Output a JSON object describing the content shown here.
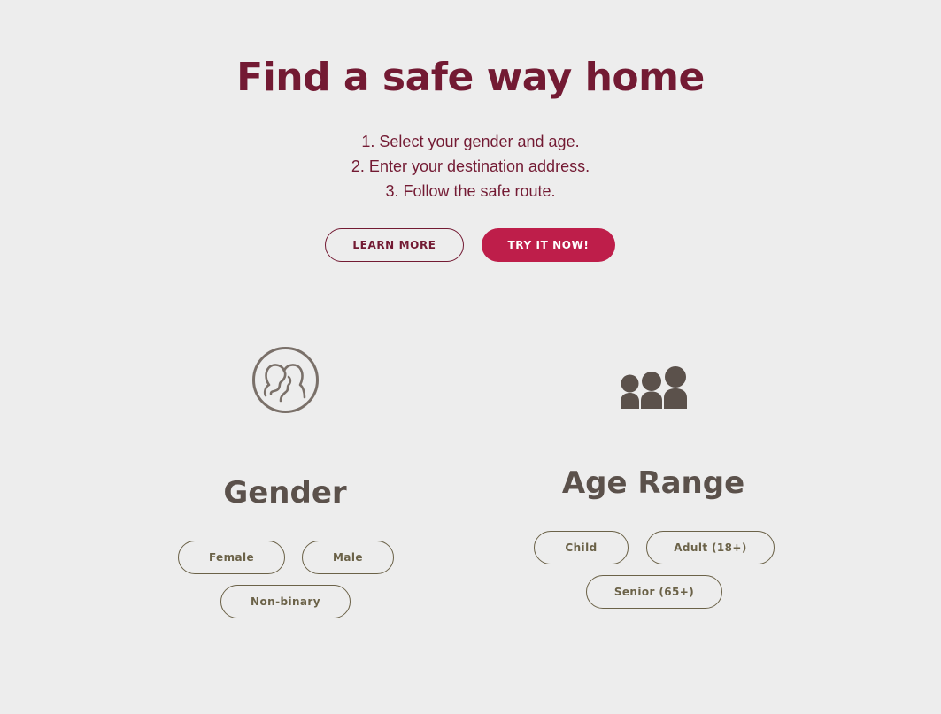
{
  "hero": {
    "title": "Find a safe way home",
    "steps": [
      "1. Select your gender and age.",
      "2. Enter your destination address.",
      "3. Follow the safe route."
    ],
    "learn_more_label": "LEARN MORE",
    "try_label": "TRY IT NOW!"
  },
  "gender": {
    "icon": "two-faces-icon",
    "title": "Gender",
    "options": [
      "Female",
      "Male",
      "Non-binary"
    ]
  },
  "age": {
    "icon": "people-group-icon",
    "title": "Age Range",
    "options": [
      "Child",
      "Adult (18+)",
      "Senior (65+)"
    ]
  },
  "colors": {
    "background": "#ededed",
    "brand_dark": "#731a33",
    "brand_accent": "#be1e4a",
    "section_text": "#5b514b",
    "pill_border": "#6b6248"
  }
}
